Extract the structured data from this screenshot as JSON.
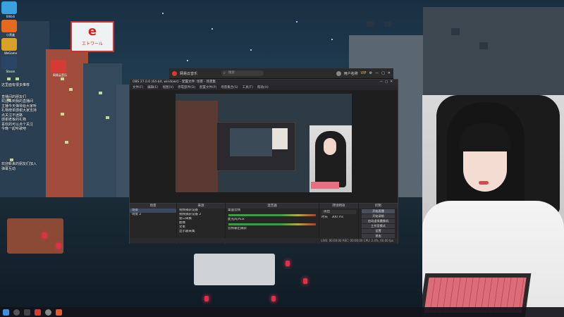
{
  "desktop": {
    "icons": [
      {
        "label": "Bilibili"
      },
      {
        "label": "小黑盒"
      },
      {
        "label": "WeGame"
      },
      {
        "label": "Steam"
      },
      {
        "label": "网易云音乐"
      }
    ],
    "overlay_lines": [
      "这里面有很多推荐",
      "直播间的朋友们",
      "欢迎来到我的直播间",
      "主播今天弹琴给大家听",
      "礼物榜单感谢大家支持",
      "点关注不迷路",
      "感谢老板的礼物",
      "喜欢的可以点个关注",
      "今晚一起听歌吧"
    ],
    "overlay_lines_lower": [
      "欢迎新来的朋友们加入",
      "弹幕互动"
    ],
    "sign_text": "エトワール"
  },
  "music_app": {
    "title": "网易云音乐",
    "search_placeholder": "搜索",
    "user": "用户名称",
    "vip": "VIP"
  },
  "obs": {
    "title": "OBS 27.0.0 (64-bit, windows) - 配置文件: 场景 - 场景集",
    "menu": [
      "文件(F)",
      "编辑(E)",
      "视图(V)",
      "停靠部件(D)",
      "配置文件(P)",
      "场景集合(S)",
      "工具(T)",
      "帮助(H)"
    ],
    "scenes": {
      "header": "场景",
      "items": [
        "场景",
        "场景 2"
      ]
    },
    "sources": {
      "header": "来源",
      "items": [
        "视频捕获设备",
        "视频捕获设备 2",
        "窗口采集",
        "图像",
        "文本",
        "显示器采集"
      ]
    },
    "mixer": {
      "header": "混音器",
      "channels": [
        {
          "name": "桌面音频",
          "level": 0.68
        },
        {
          "name": "麦克风/Aux",
          "level": 0.52
        },
        {
          "name": "音频输出捕获",
          "level": 0.0
        }
      ]
    },
    "transitions": {
      "header": "转场特效",
      "type": "淡出",
      "duration_label": "时长",
      "duration": "300 ms"
    },
    "controls": {
      "header": "控制",
      "buttons": [
        "开始直播",
        "开始录制",
        "启动虚拟摄像机",
        "工作室模式",
        "设置",
        "退出"
      ]
    },
    "status": "LIVE: 00:00:00  REC: 00:00:00  CPU: 2.4%, 60.00 fps"
  },
  "colors": {
    "obs_bg": "#1e1e1e",
    "accent_live": "#2fbf3a",
    "lantern": "#e2304a",
    "keyboard_pink": "#e6707d"
  },
  "icons": [
    "search-icon",
    "minimize-icon",
    "maximize-icon",
    "close-icon",
    "windows-start-icon",
    "gear-icon"
  ]
}
